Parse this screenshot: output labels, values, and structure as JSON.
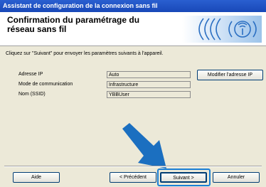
{
  "window": {
    "title": "Assistant de configuration de la connexion sans fil"
  },
  "header": {
    "title_line1": "Confirmation du paramétrage du",
    "title_line2": "réseau sans fil"
  },
  "instruction": "Cliquez sur \"Suivant\" pour envoyer les paramètres suivants à l'appareil.",
  "settings": [
    {
      "label": "Adresse IP",
      "value": "Auto"
    },
    {
      "label": "Mode de communication",
      "value": "Infrastructure"
    },
    {
      "label": "Nom (SSID)",
      "value": "YBBUser"
    }
  ],
  "buttons": {
    "modify_ip": "Modifier l'adresse IP",
    "help": "Aide",
    "previous": "< Précédent",
    "next": "Suivant >",
    "cancel": "Annuler"
  },
  "colors": {
    "titlebar": "#1848b8",
    "highlight": "#1b7fd6",
    "arrow": "#1b6fc0"
  }
}
